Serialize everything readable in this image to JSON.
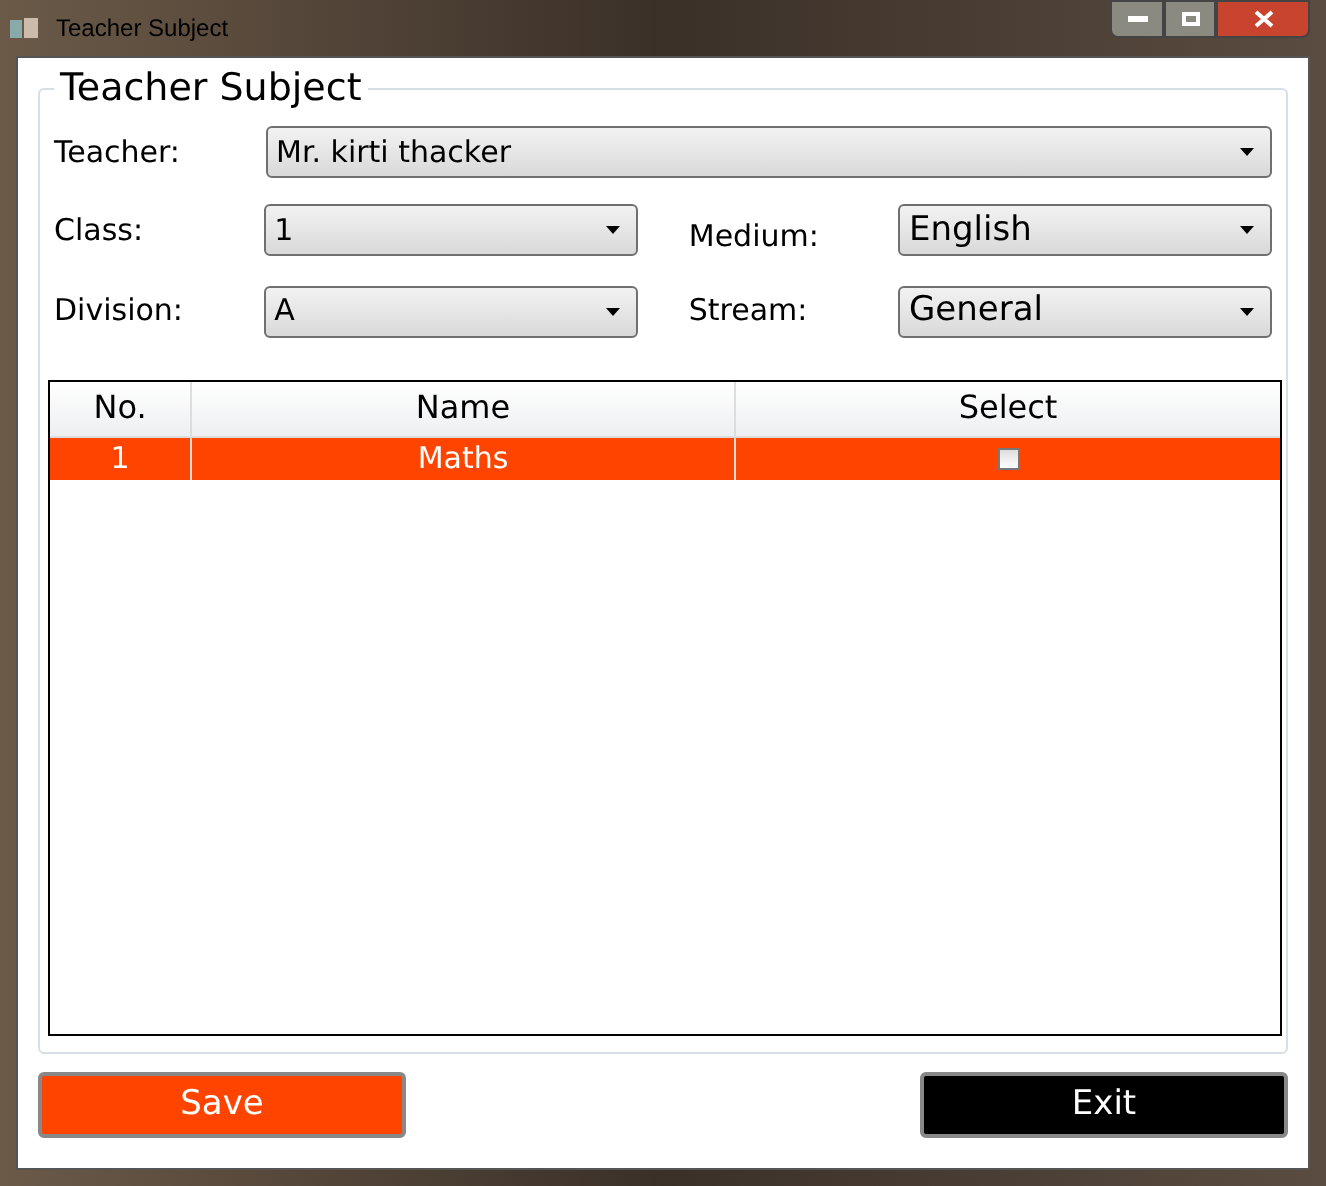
{
  "window": {
    "title": "Teacher Subject"
  },
  "group": {
    "title": "Teacher Subject"
  },
  "fields": [
    {
      "label": "Teacher:",
      "value": "Mr. kirti thacker"
    },
    {
      "label": "Class:",
      "value": "1"
    },
    {
      "label": "Medium:",
      "value": "English"
    },
    {
      "label": "Division:",
      "value": "A"
    },
    {
      "label": "Stream:",
      "value": "General"
    }
  ],
  "table": {
    "columns": [
      "No.",
      "Name",
      "Select"
    ],
    "rows": [
      {
        "no": "1",
        "name": "Maths",
        "checked": false,
        "selected": true
      }
    ]
  },
  "buttons": [
    {
      "label": "Save",
      "kind": "primary"
    },
    {
      "label": "Exit",
      "kind": "dark"
    }
  ]
}
